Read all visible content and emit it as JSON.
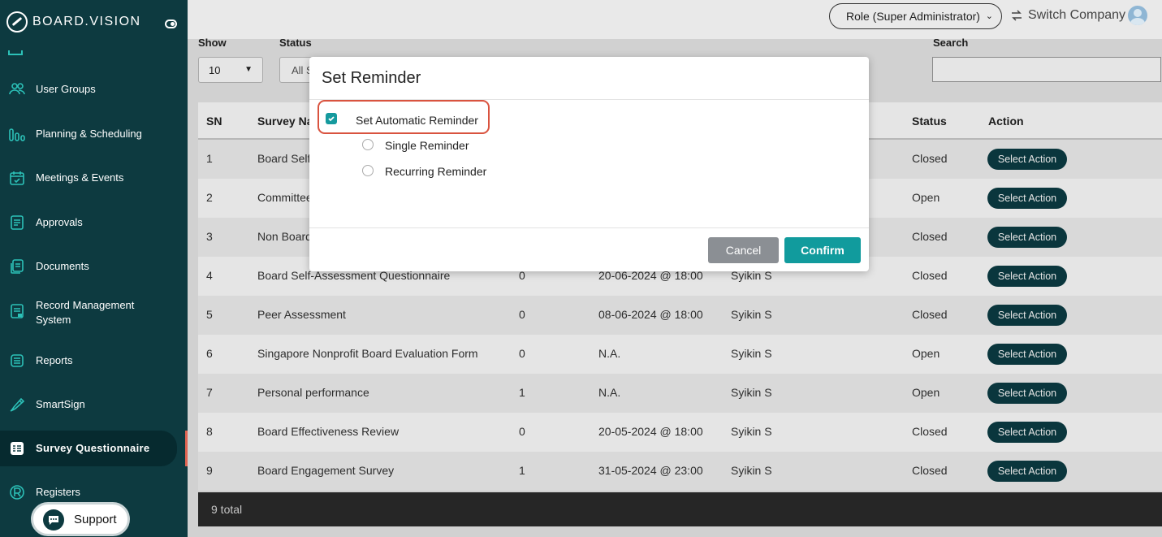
{
  "brand": {
    "name": "BOARD.VISION"
  },
  "sidebar": {
    "items": [
      {
        "label": "User Groups",
        "icon": "users-icon"
      },
      {
        "label": "Planning & Scheduling",
        "icon": "bar-chart-icon"
      },
      {
        "label": "Meetings & Events",
        "icon": "calendar-check-icon"
      },
      {
        "label": "Approvals",
        "icon": "document-list-icon"
      },
      {
        "label": "Documents",
        "icon": "documents-icon"
      },
      {
        "label": "Record Management System",
        "icon": "record-icon"
      },
      {
        "label": "Reports",
        "icon": "report-icon"
      },
      {
        "label": "SmartSign",
        "icon": "pen-icon"
      },
      {
        "label": "Survey Questionnaire",
        "icon": "survey-icon",
        "active": true
      },
      {
        "label": "Registers",
        "icon": "registered-icon"
      }
    ],
    "support_label": "Support"
  },
  "header": {
    "role_label": "Role (Super Administrator)",
    "switch_company_label": "Switch Company"
  },
  "filters": {
    "show_label": "Show",
    "show_value": "10",
    "status_label": "Status",
    "status_value": "All S",
    "search_label": "Search",
    "search_value": ""
  },
  "table": {
    "headers": {
      "sn": "SN",
      "name": "Survey Na",
      "status": "Status",
      "action": "Action"
    },
    "rows": [
      {
        "sn": "1",
        "name": "Board Self",
        "count": "",
        "date": "",
        "owner": "",
        "status": "Closed",
        "action": "Select Action"
      },
      {
        "sn": "2",
        "name": "Committee",
        "count": "",
        "date": "",
        "owner": "",
        "status": "Open",
        "action": "Select Action"
      },
      {
        "sn": "3",
        "name": "Non Board",
        "count": "",
        "date": "",
        "owner": "",
        "status": "Closed",
        "action": "Select Action"
      },
      {
        "sn": "4",
        "name": "Board Self-Assessment Questionnaire",
        "count": "0",
        "date": "20-06-2024 @ 18:00",
        "owner": "Syikin S",
        "status": "Closed",
        "action": "Select Action"
      },
      {
        "sn": "5",
        "name": "Peer Assessment",
        "count": "0",
        "date": "08-06-2024 @ 18:00",
        "owner": "Syikin S",
        "status": "Closed",
        "action": "Select Action"
      },
      {
        "sn": "6",
        "name": "Singapore Nonprofit Board Evaluation Form",
        "count": "0",
        "date": "N.A.",
        "owner": "Syikin S",
        "status": "Open",
        "action": "Select Action"
      },
      {
        "sn": "7",
        "name": "Personal performance",
        "count": "1",
        "date": "N.A.",
        "owner": "Syikin S",
        "status": "Open",
        "action": "Select Action"
      },
      {
        "sn": "8",
        "name": "Board Effectiveness Review",
        "count": "0",
        "date": "20-05-2024 @ 18:00",
        "owner": "Syikin S",
        "status": "Closed",
        "action": "Select Action"
      },
      {
        "sn": "9",
        "name": "Board Engagement Survey",
        "count": "1",
        "date": "31-05-2024 @ 23:00",
        "owner": "Syikin S",
        "status": "Closed",
        "action": "Select Action"
      }
    ],
    "footer": "9 total"
  },
  "modal": {
    "title": "Set Reminder",
    "auto_reminder_label": "Set Automatic Reminder",
    "auto_reminder_checked": true,
    "options": [
      {
        "label": "Single Reminder",
        "selected": false
      },
      {
        "label": "Recurring Reminder",
        "selected": false
      }
    ],
    "cancel_label": "Cancel",
    "confirm_label": "Confirm"
  },
  "colors": {
    "sidebar_bg": "#0d3a40",
    "accent_teal": "#119b9d",
    "highlight_red": "#d9533f",
    "action_btn": "#0c3d44"
  }
}
